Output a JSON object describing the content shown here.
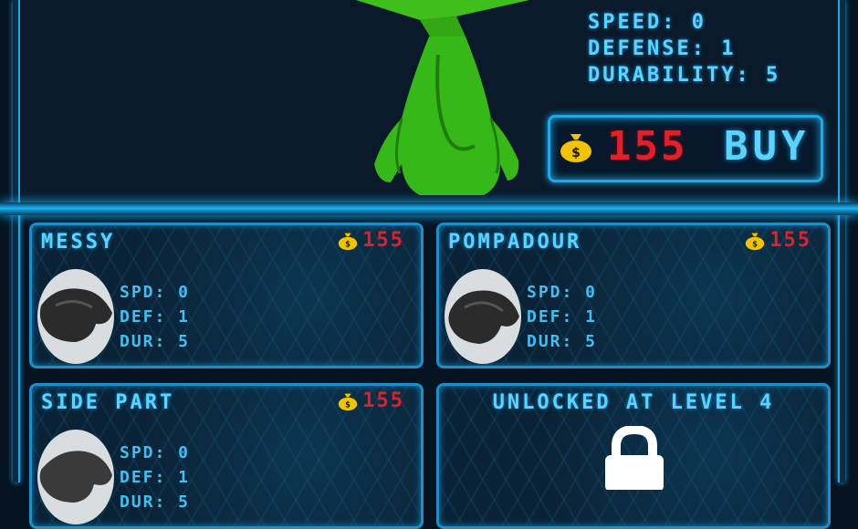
{
  "featured": {
    "stats": [
      "SPEED: 0",
      "DEFENSE: 1",
      "DURABILITY: 5"
    ],
    "price": "155",
    "buy_label": "BUY"
  },
  "items": [
    {
      "name": "MESSY",
      "price": "155",
      "stats": [
        "SPD: 0",
        "DEF: 1",
        "DUR: 5"
      ]
    },
    {
      "name": "POMPADOUR",
      "price": "155",
      "stats": [
        "SPD: 0",
        "DEF: 1",
        "DUR: 5"
      ]
    },
    {
      "name": "SIDE PART",
      "price": "155",
      "stats": [
        "SPD: 0",
        "DEF: 1",
        "DUR: 5"
      ]
    }
  ],
  "locked": {
    "label": "UNLOCKED AT LEVEL 4"
  },
  "icons": {
    "currency": "money-bag-icon",
    "lock": "lock-icon"
  },
  "colors": {
    "accent": "#5ad4ff",
    "price": "#e1202a",
    "frame": "#1fa8e6"
  }
}
